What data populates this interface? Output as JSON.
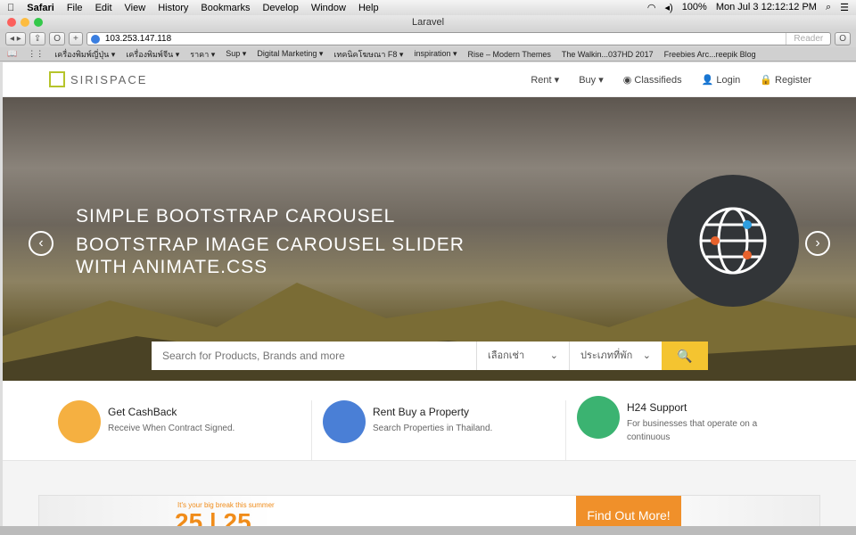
{
  "menubar": {
    "app": "Safari",
    "items": [
      "File",
      "Edit",
      "View",
      "History",
      "Bookmarks",
      "Develop",
      "Window",
      "Help"
    ],
    "battery": "100%",
    "clock": "Mon Jul 3  12:12:12 PM"
  },
  "window": {
    "title": "Laravel",
    "url": "103.253.147.118",
    "reader": "Reader"
  },
  "bookmarks": [
    "เครื่องพิมพ์ญี่ปุ่น ▾",
    "เครื่องพิมพ์จีน ▾",
    "ราคา ▾",
    "Sup ▾",
    "Digital Marketing ▾",
    "เทคนิคโฆษณา F8 ▾",
    "inspiration ▾",
    "Rise – Modern Themes",
    "The Walkin...037HD 2017",
    "Freebies Arc...reepik Blog"
  ],
  "nav": {
    "logo": "SIRISPACE",
    "links": [
      "Rent ▾",
      "Buy ▾",
      "◉ Classifieds",
      "Login",
      "Register"
    ]
  },
  "hero": {
    "line1": "SIMPLE BOOTSTRAP CAROUSEL",
    "line2": "BOOTSTRAP IMAGE CAROUSEL SLIDER",
    "line3": "WITH ANIMATE.CSS",
    "search_placeholder": "Search for Products, Brands and more",
    "select1": "เลือกเช่า",
    "select2": "ประเภทที่พัก"
  },
  "features": [
    {
      "title": "Get CashBack",
      "desc": "Receive When Contract Signed.",
      "color": "#f5b041"
    },
    {
      "title": "Rent Buy a Property",
      "desc": "Search Properties in Thailand.",
      "color": "#4a7fd6"
    },
    {
      "title": "H24 Support",
      "desc": "For businesses that operate on a continuous",
      "color": "#3bb371"
    }
  ],
  "promo": {
    "tagline": "It's your big break this summer",
    "big": "25 | 25",
    "button": "Find Out More!"
  }
}
